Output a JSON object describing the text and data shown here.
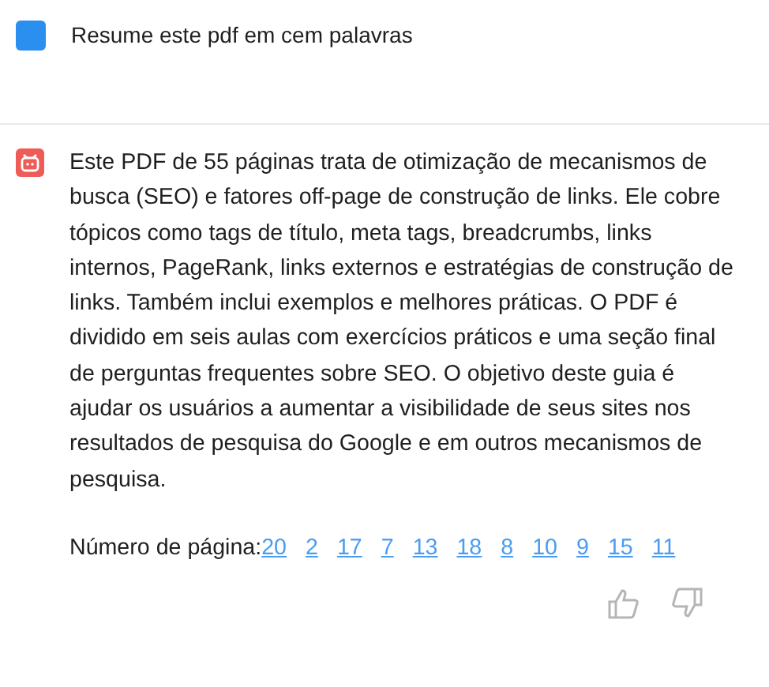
{
  "user_message": {
    "text": "Resume este pdf em cem palavras"
  },
  "bot_message": {
    "text": "Este PDF de 55 páginas trata de otimização de mecanismos de busca (SEO) e fatores off-page de construção de links. Ele cobre tópicos como tags de título, meta tags, breadcrumbs, links internos, PageRank, links externos e estratégias de construção de links. Também inclui exemplos e melhores práticas. O PDF é dividido em seis aulas com exercícios práticos e uma seção final de perguntas frequentes sobre SEO. O objetivo deste guia é ajudar os usuários a aumentar a visibilidade de seus sites nos resultados de pesquisa do Google e em outros mecanismos de pesquisa.",
    "page_label": "Número de página:",
    "pages": [
      "20",
      "2",
      "17",
      "7",
      "13",
      "18",
      "8",
      "10",
      "9",
      "15",
      "11"
    ]
  }
}
